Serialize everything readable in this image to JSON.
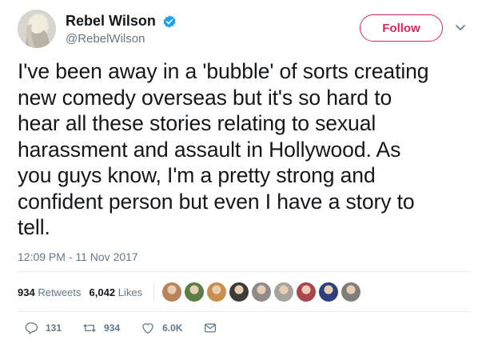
{
  "user": {
    "display_name": "Rebel Wilson",
    "handle": "@RebelWilson",
    "verified": true
  },
  "follow_label": "Follow",
  "tweet": {
    "lines": [
      "I've been away in a 'bubble' of sorts creating",
      "new comedy overseas but it's so hard to",
      "hear all these stories relating to sexual",
      "harassment and assault in Hollywood. As",
      "you guys know, I'm a pretty strong and",
      "confident person but even I have a story to",
      "tell."
    ],
    "timestamp": "12:09 PM - 11 Nov 2017"
  },
  "stats": {
    "retweets_count": "934",
    "retweets_label": "Retweets",
    "likes_count": "6,042",
    "likes_label": "Likes"
  },
  "liker_avatars": [
    "#b9835c",
    "#5d7d46",
    "#c98f4a",
    "#3f3a36",
    "#8d8c8a",
    "#a7a49d",
    "#a8484e",
    "#2d3f7c",
    "#7e7f7b"
  ],
  "actions": {
    "reply_count": "131",
    "retweet_count": "934",
    "like_count": "6.0K"
  },
  "colors": {
    "accent": "#e0245e",
    "verified": "#1da1f2",
    "muted": "#657786",
    "text": "#14171a"
  },
  "icons": [
    "verified-badge-icon",
    "chevron-down-icon",
    "reply-icon",
    "retweet-icon",
    "like-icon",
    "direct-message-icon"
  ]
}
